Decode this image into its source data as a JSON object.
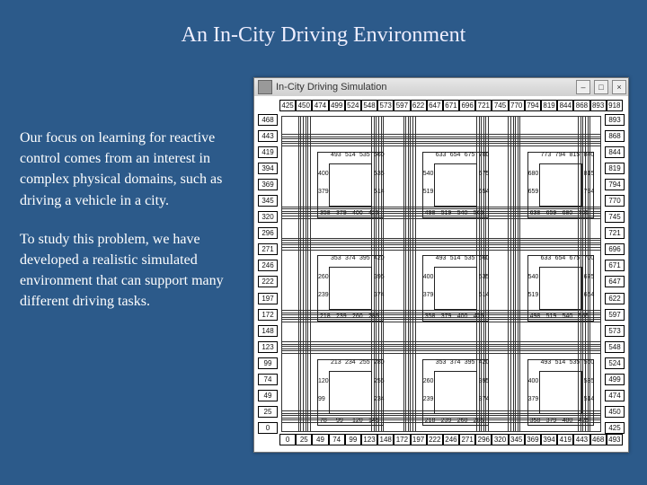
{
  "title": "An In-City Driving Environment",
  "para1": "Our focus on learning for reactive control comes from an interest in complex physical domains, such as driving a vehicle in a city.",
  "para2": "To study this problem, we have developed a realistic simulated environment that can support many different driving tasks.",
  "window_title": "In-City Driving Simulation",
  "ruler_top": [
    "425",
    "450",
    "474",
    "499",
    "524",
    "548",
    "573",
    "597",
    "622",
    "647",
    "671",
    "696",
    "721",
    "745",
    "770",
    "794",
    "819",
    "844",
    "868",
    "893",
    "918"
  ],
  "ruler_bottom": [
    "0",
    "25",
    "49",
    "74",
    "99",
    "123",
    "148",
    "172",
    "197",
    "222",
    "246",
    "271",
    "296",
    "320",
    "345",
    "369",
    "394",
    "419",
    "443",
    "468",
    "493"
  ],
  "ruler_left": [
    "468",
    "443",
    "419",
    "394",
    "369",
    "345",
    "320",
    "296",
    "271",
    "246",
    "222",
    "197",
    "172",
    "148",
    "123",
    "99",
    "74",
    "49",
    "25",
    "0"
  ],
  "ruler_right": [
    "893",
    "868",
    "844",
    "819",
    "794",
    "770",
    "745",
    "721",
    "696",
    "671",
    "647",
    "622",
    "597",
    "573",
    "548",
    "524",
    "499",
    "474",
    "450",
    "425"
  ],
  "blocks": {
    "r0c0": {
      "edges": [
        "493",
        "514",
        "535",
        "560",
        "400",
        "535",
        "379",
        "514",
        "358",
        "379",
        "400",
        "425"
      ]
    },
    "r0c1": {
      "edges": [
        "633",
        "654",
        "675",
        "700",
        "540",
        "675",
        "519",
        "654",
        "498",
        "519",
        "540",
        "565"
      ]
    },
    "r0c2": {
      "edges": [
        "773",
        "794",
        "815",
        "840",
        "680",
        "815",
        "659",
        "794",
        "638",
        "659",
        "680",
        "705"
      ]
    },
    "r1c0": {
      "edges": [
        "353",
        "374",
        "395",
        "420",
        "260",
        "395",
        "239",
        "374",
        "218",
        "239",
        "260",
        "285"
      ]
    },
    "r1c1": {
      "edges": [
        "493",
        "514",
        "535",
        "560",
        "400",
        "535",
        "379",
        "514",
        "358",
        "379",
        "400",
        "425"
      ]
    },
    "r1c2": {
      "edges": [
        "633",
        "654",
        "675",
        "700",
        "540",
        "675",
        "519",
        "654",
        "498",
        "519",
        "540",
        "565"
      ]
    },
    "r2c0": {
      "edges": [
        "213",
        "234",
        "255",
        "280",
        "120",
        "255",
        "99",
        "234",
        "78",
        "99",
        "120",
        "145"
      ]
    },
    "r2c1": {
      "edges": [
        "353",
        "374",
        "395",
        "420",
        "260",
        "395",
        "239",
        "374",
        "218",
        "239",
        "260",
        "285"
      ]
    },
    "r2c2": {
      "edges": [
        "493",
        "514",
        "535",
        "560",
        "400",
        "535",
        "379",
        "514",
        "358",
        "379",
        "400",
        "425"
      ]
    }
  }
}
